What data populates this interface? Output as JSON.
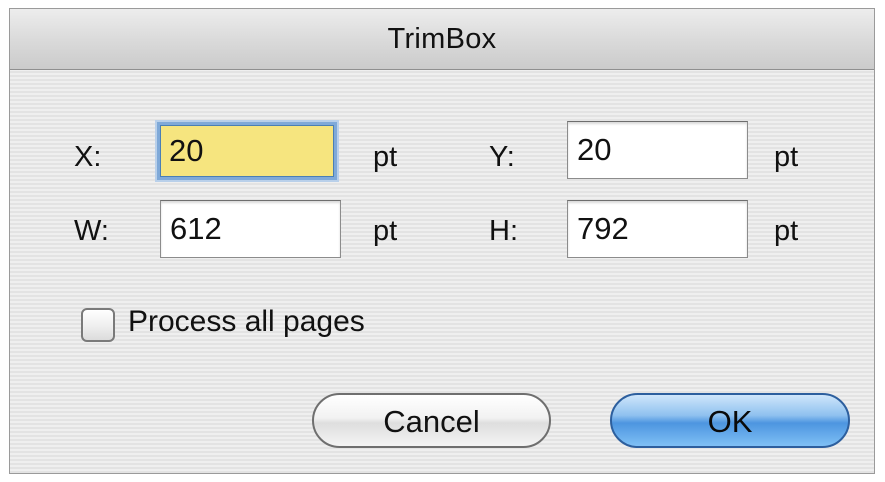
{
  "dialog": {
    "title": "TrimBox"
  },
  "fields": {
    "x": {
      "label": "X:",
      "value": "20",
      "unit": "pt"
    },
    "y": {
      "label": "Y:",
      "value": "20",
      "unit": "pt"
    },
    "w": {
      "label": "W:",
      "value": "612",
      "unit": "pt"
    },
    "h": {
      "label": "H:",
      "value": "792",
      "unit": "pt"
    }
  },
  "checkbox": {
    "label": "Process all pages",
    "checked": false
  },
  "buttons": {
    "cancel": "Cancel",
    "ok": "OK"
  },
  "colors": {
    "focused_field_bg": "#f6e57f",
    "focus_ring": "#7fa9d8",
    "default_button": "#4d95e0"
  }
}
